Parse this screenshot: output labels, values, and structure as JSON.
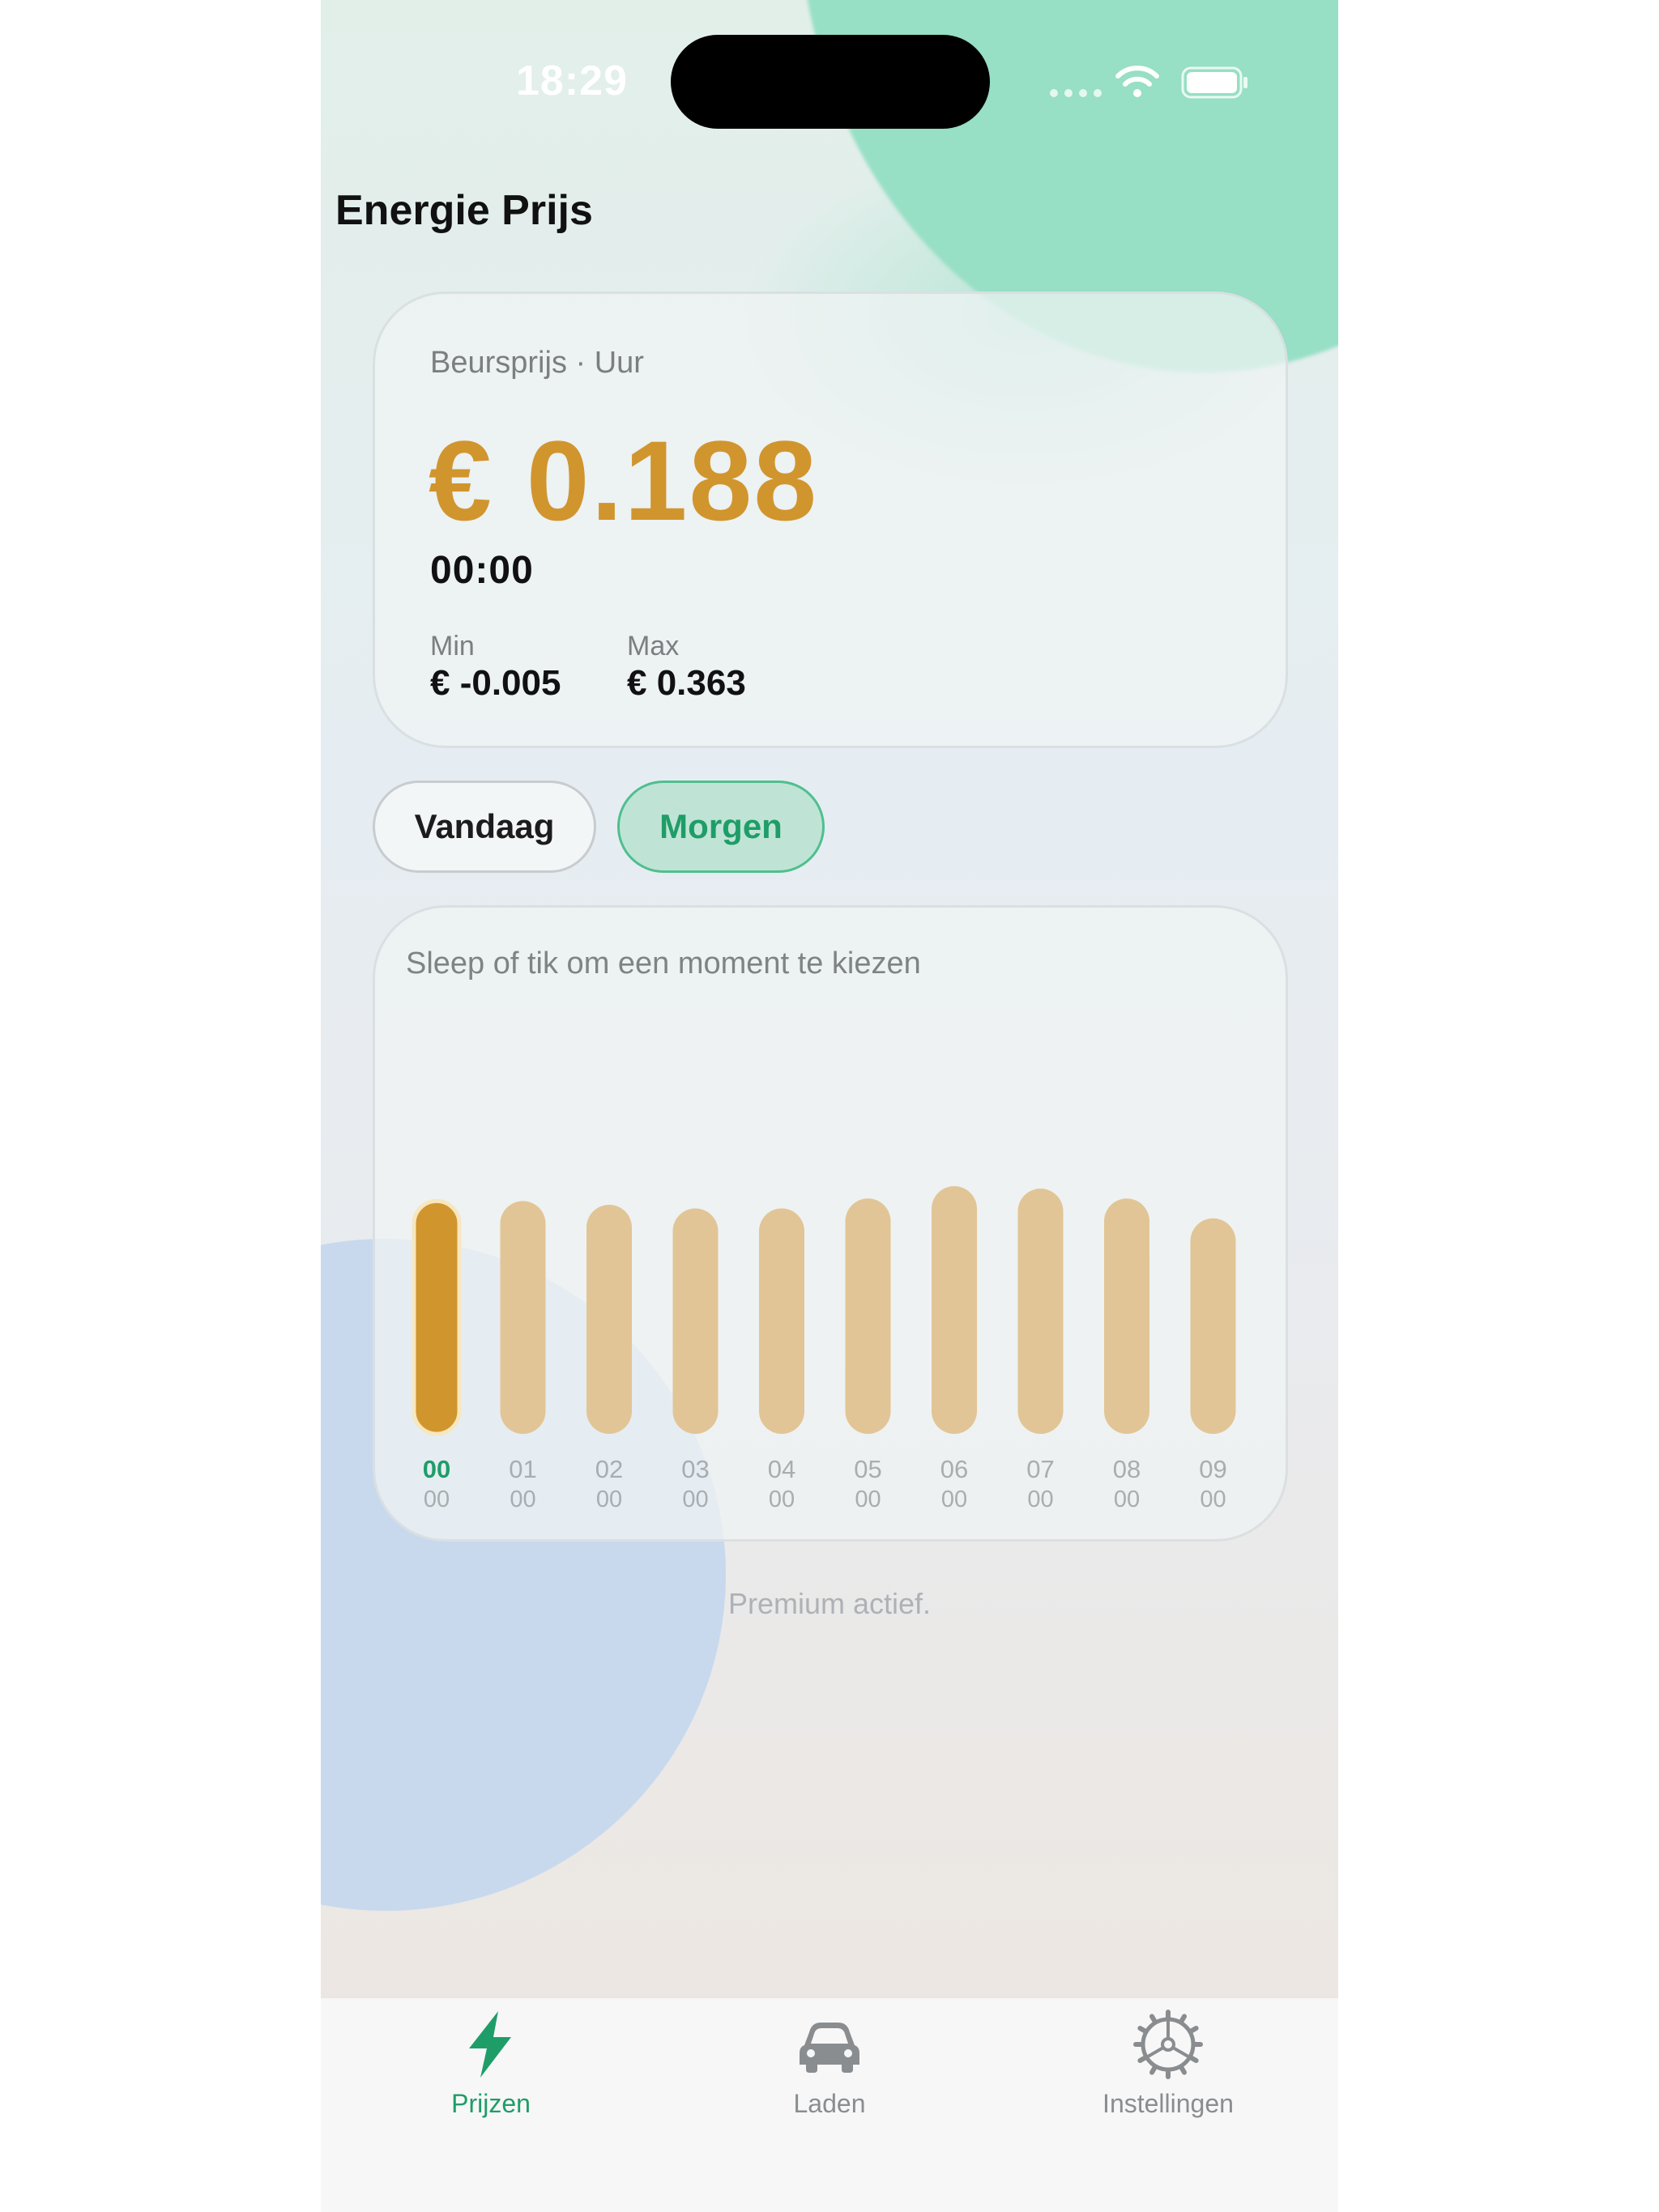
{
  "status_bar": {
    "time": "18:29",
    "icons": [
      "signal-dots-icon",
      "wifi-icon",
      "battery-icon"
    ]
  },
  "header": {
    "title": "Energie Prijs"
  },
  "price_card": {
    "label": "Beursprijs · Uur",
    "price": "€ 0.188",
    "time": "00:00",
    "min_label": "Min",
    "min_value": "€ -0.005",
    "max_label": "Max",
    "max_value": "€ 0.363"
  },
  "day_toggle": {
    "today_label": "Vandaag",
    "tomorrow_label": "Morgen",
    "selected": "Morgen"
  },
  "chart_card": {
    "hint": "Sleep of tik om een moment te kiezen"
  },
  "chart_data": {
    "type": "bar",
    "categories": [
      "00 00",
      "01 00",
      "02 00",
      "03 00",
      "04 00",
      "05 00",
      "06 00",
      "07 00",
      "08 00",
      "09 00"
    ],
    "hour_labels": [
      "00",
      "01",
      "02",
      "03",
      "04",
      "05",
      "06",
      "07",
      "08",
      "09"
    ],
    "minute_labels": [
      "00",
      "00",
      "00",
      "00",
      "00",
      "00",
      "00",
      "00",
      "00",
      "00"
    ],
    "values": [
      0.188,
      0.188,
      0.185,
      0.182,
      0.182,
      0.19,
      0.2,
      0.198,
      0.19,
      0.174
    ],
    "selected_index": 0,
    "colors": {
      "selected_bar": "#d1952e",
      "bar": "#e2c596",
      "selected_label": "#1f9d68",
      "label": "#a9adb0"
    }
  },
  "footer": {
    "premium_text": "Premium actief."
  },
  "tab_bar": {
    "tabs": [
      {
        "label": "Prijzen",
        "icon": "lightning-icon",
        "active": true
      },
      {
        "label": "Laden",
        "icon": "car-icon",
        "active": false
      },
      {
        "label": "Instellingen",
        "icon": "gear-icon",
        "active": false
      }
    ],
    "colors": {
      "active": "#1f9d68",
      "inactive": "#8a8d90"
    }
  }
}
